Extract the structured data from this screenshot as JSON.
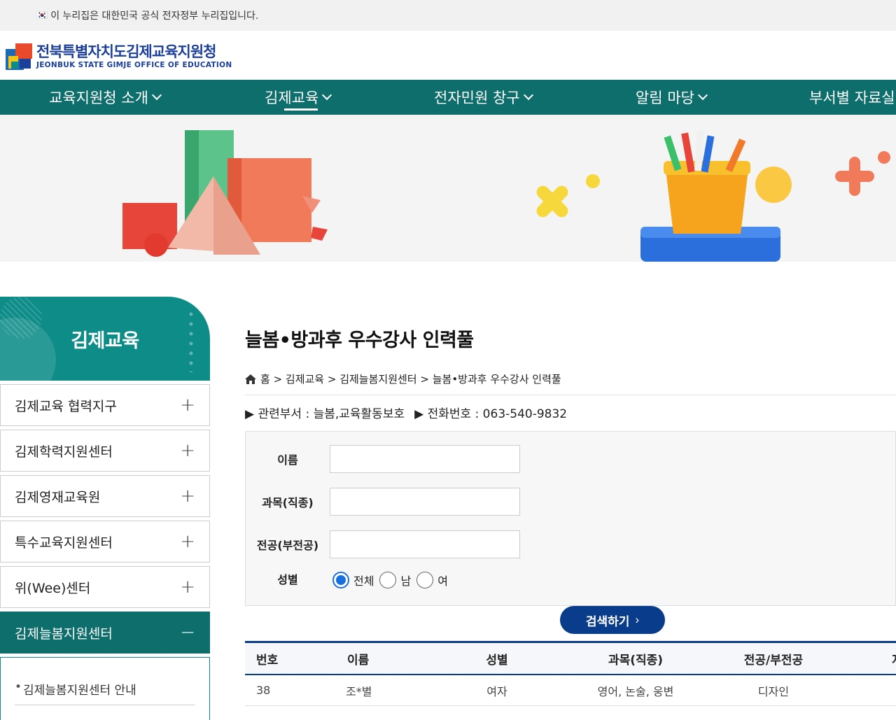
{
  "gov_bar": {
    "flag": "🇰🇷",
    "text": "이 누리집은 대한민국 공식 전자정부 누리집입니다."
  },
  "logo": {
    "ko": "전북특별자치도김제교육지원청",
    "en": "JEONBUK STATE GIMJE OFFICE OF EDUCATION"
  },
  "gnb": [
    {
      "label": "교육지원청 소개"
    },
    {
      "label": "김제교육"
    },
    {
      "label": "전자민원 창구"
    },
    {
      "label": "알림 마당"
    },
    {
      "label": "부서별 자료실"
    }
  ],
  "sidebar": {
    "title": "김제교육",
    "items": [
      {
        "label": "김제교육 협력지구",
        "toggle": "+"
      },
      {
        "label": "김제학력지원센터",
        "toggle": "+"
      },
      {
        "label": "김제영재교육원",
        "toggle": "+"
      },
      {
        "label": "특수교육지원센터",
        "toggle": "+"
      },
      {
        "label": "위(Wee)센터",
        "toggle": "+"
      },
      {
        "label": "김제늘봄지원센터",
        "toggle": "−"
      }
    ],
    "sub_items": [
      {
        "label": "김제늘봄지원센터 안내"
      }
    ]
  },
  "page": {
    "title": "늘봄•방과후 우수강사 인력풀",
    "breadcrumb": "홈 > 김제교육 > 김제늘봄지원센터 > 늘봄•방과후 우수강사 인력풀",
    "dept": "▶ 관련부서 : 늘봄,교육활동보호",
    "phone": "▶ 전화번호 : 063-540-9832"
  },
  "search": {
    "name_label": "이름",
    "name_value": "",
    "subject_label": "과목(직종)",
    "subject_value": "",
    "major_label": "전공(부전공)",
    "major_value": "",
    "gender_label": "성별",
    "gender_options": [
      "전체",
      "남",
      "여"
    ],
    "gender_selected": "전체",
    "button": "검색하기",
    "button_arrow": "›"
  },
  "table": {
    "headers": [
      "번호",
      "이름",
      "성별",
      "과목(직종)",
      "전공/부전공",
      "지"
    ],
    "rows": [
      [
        "38",
        "조*별",
        "여자",
        "영어, 논술, 웅변",
        "디자인",
        ""
      ]
    ]
  },
  "colors": {
    "primary": "#0d6e6b",
    "accent": "#0d8c88",
    "navy": "#0a3c8c"
  }
}
